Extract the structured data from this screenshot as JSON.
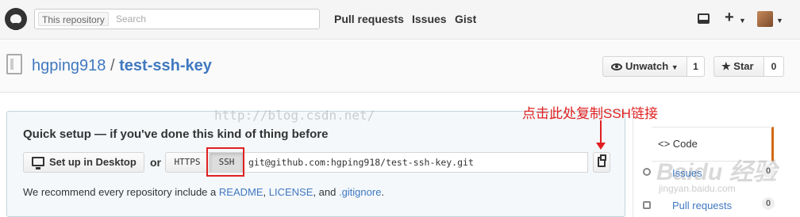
{
  "header": {
    "search_scope": "This repository",
    "search_placeholder": "Search",
    "nav": [
      "Pull requests",
      "Issues",
      "Gist"
    ]
  },
  "repo": {
    "owner": "hgping918",
    "separator": "/",
    "name": "test-ssh-key",
    "watch_label": "Unwatch",
    "watch_count": "1",
    "star_label": "Star",
    "star_count": "0"
  },
  "setup": {
    "title": "Quick setup — if you've done this kind of thing before",
    "desktop_button": "Set up in Desktop",
    "or_text": "or",
    "https_label": "HTTPS",
    "ssh_label": "SSH",
    "clone_url": "git@github.com:hgping918/test-ssh-key.git",
    "recommend_prefix": "We recommend every repository include a",
    "readme": "README",
    "comma1": ",",
    "license": "LICENSE",
    "and_text": ", and",
    "gitignore": ".gitignore",
    "period": "."
  },
  "annotation": {
    "text": "点击此处复制SSH链接",
    "watermark": "http://blog.csdn.net/",
    "color": "#e02020"
  },
  "sidebar": {
    "code_label": "<> Code",
    "issues_label": "Issues",
    "issues_count": "0",
    "pr_label": "Pull requests",
    "pr_count": "0",
    "baidu_logo": "Baidu 经验",
    "baidu_url": "jingyan.baidu.com"
  },
  "colors": {
    "link": "#4078c0",
    "accent": "#d26911"
  }
}
